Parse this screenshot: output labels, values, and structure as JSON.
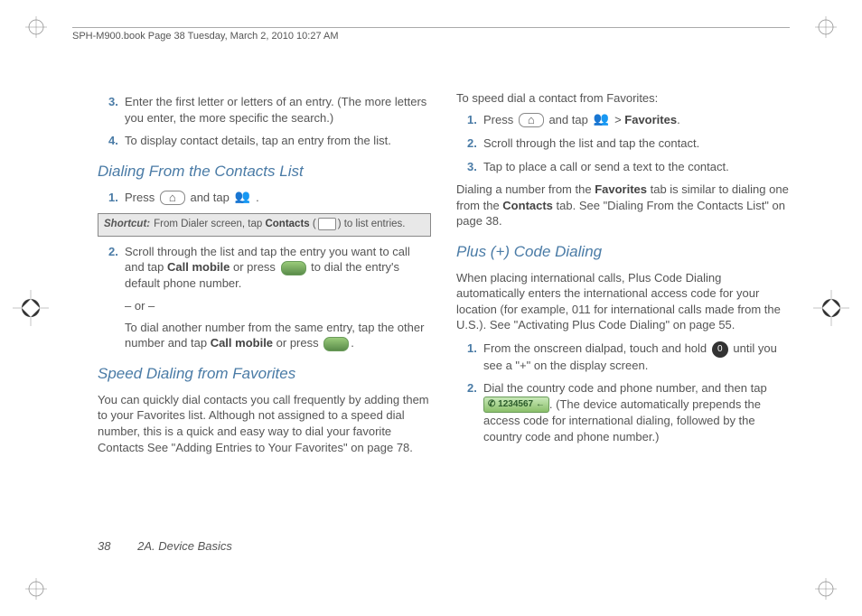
{
  "header": "SPH-M900.book  Page 38  Tuesday, March 2, 2010  10:27 AM",
  "footer": {
    "page": "38",
    "section": "2A. Device Basics"
  },
  "left": {
    "step3": "Enter the first letter or letters of an entry. (The more letters you enter, the more specific the search.)",
    "step4": "To display contact details, tap an entry from the list.",
    "h1": "Dialing From the Contacts List",
    "d1_press": "Press ",
    "d1_andtap": " and tap ",
    "d1_period": ".",
    "shortcut_label": "Shortcut:",
    "shortcut_a": "From Dialer screen, tap ",
    "shortcut_bold": "Contacts",
    "shortcut_b": " (",
    "shortcut_c": ") to list entries.",
    "d2_a": "Scroll through the list and tap the entry you want to call and tap ",
    "d2_bold1": "Call mobile",
    "d2_b": " or press ",
    "d2_c": " to dial the entry's default phone number.",
    "or": "– or –",
    "d2_alt_a": "To dial another number from the same entry, tap the other number and tap ",
    "d2_alt_bold": "Call mobile",
    "d2_alt_b": " or press ",
    "d2_alt_c": ".",
    "h2": "Speed Dialing from Favorites",
    "para": "You can quickly dial contacts you call frequently by adding them to your Favorites list. Although not assigned to a speed dial number, this is a quick and easy way to dial your favorite Contacts See \"Adding Entries to Your Favorites\" on page 78."
  },
  "right": {
    "intro": "To speed dial a contact from Favorites:",
    "s1_press": "Press ",
    "s1_andtap": " and tap ",
    "s1_gt": " > ",
    "s1_fav": "Favorites",
    "s1_period": ".",
    "s2": "Scroll through the list and tap the contact.",
    "s3": "Tap to place a call or send a text to the contact.",
    "para1_a": "Dialing a number from the ",
    "para1_fav": "Favorites",
    "para1_b": " tab is similar to dialing one from the ",
    "para1_con": "Contacts",
    "para1_c": " tab. See \"Dialing From the Contacts List\" on page 38.",
    "h3": "Plus (+) Code Dialing",
    "para2": "When placing international calls, Plus Code Dialing automatically enters the international access code for your location (for example, 011 for international calls made from the U.S.). See \"Activating Plus Code Dialing\" on page 55.",
    "p1_a": "From the onscreen dialpad, touch and hold ",
    "p1_b": " until you see a \"+\" on the display screen.",
    "p2_a": "Dial the country code and phone number, and then tap ",
    "dialbar": "✆ 1234567  ←",
    "p2_b": ". (The device automatically prepends the access code for international dialing, followed by the country code and phone number.)",
    "zero": "0"
  }
}
